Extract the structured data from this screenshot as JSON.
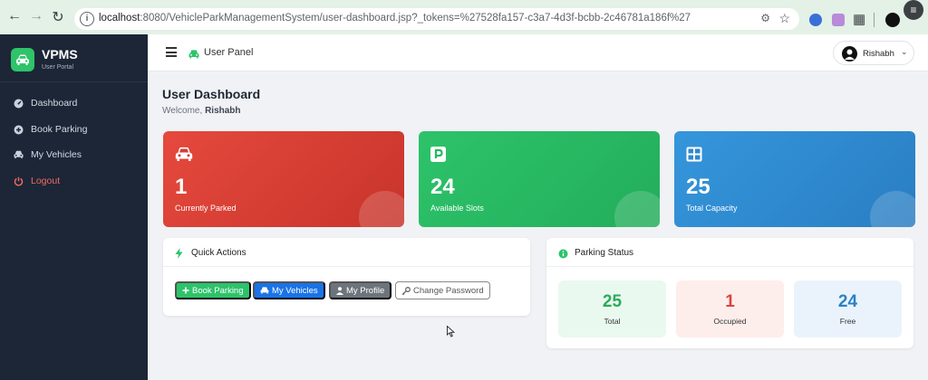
{
  "browser": {
    "url_host": "localhost",
    "url_rest": ":8080/VehicleParkManagementSystem/user-dashboard.jsp?_tokens=%27528fa157-c3a7-4d3f-bcbb-2c46781a186f%27",
    "back_icon": "back-arrow-icon",
    "forward_icon": "forward-arrow-icon",
    "reload_icon": "reload-icon"
  },
  "sidebar": {
    "brand_name": "VPMS",
    "brand_sub": "User Portal",
    "items": [
      {
        "label": "Dashboard",
        "icon": "dashboard-gauge-icon"
      },
      {
        "label": "Book Parking",
        "icon": "plus-circle-icon"
      },
      {
        "label": "My Vehicles",
        "icon": "car-icon"
      },
      {
        "label": "Logout",
        "icon": "power-icon"
      }
    ]
  },
  "topbar": {
    "title": "User Panel",
    "user_name": "Rishabh"
  },
  "page": {
    "title": "User Dashboard",
    "welcome_prefix": "Welcome, ",
    "welcome_name": "Rishabh"
  },
  "stats": [
    {
      "value": "1",
      "label": "Currently Parked",
      "icon": "car-icon",
      "color": "#e6493d"
    },
    {
      "value": "24",
      "label": "Available Slots",
      "icon": "parking-icon",
      "color": "#2dc36a"
    },
    {
      "value": "25",
      "label": "Total Capacity",
      "icon": "grid-icon",
      "color": "#3596dc"
    }
  ],
  "quick_actions": {
    "title": "Quick Actions",
    "buttons": [
      {
        "label": "Book Parking"
      },
      {
        "label": "My Vehicles"
      },
      {
        "label": "My Profile"
      },
      {
        "label": "Change Password"
      }
    ]
  },
  "parking_status": {
    "title": "Parking Status",
    "tiles": [
      {
        "value": "25",
        "label": "Total"
      },
      {
        "value": "1",
        "label": "Occupied"
      },
      {
        "value": "24",
        "label": "Free"
      }
    ]
  },
  "colors": {
    "sidebar_bg": "#1c2637",
    "accent_green": "#2dc36a",
    "accent_blue": "#1a73e8",
    "logout_red": "#f26a5f"
  }
}
